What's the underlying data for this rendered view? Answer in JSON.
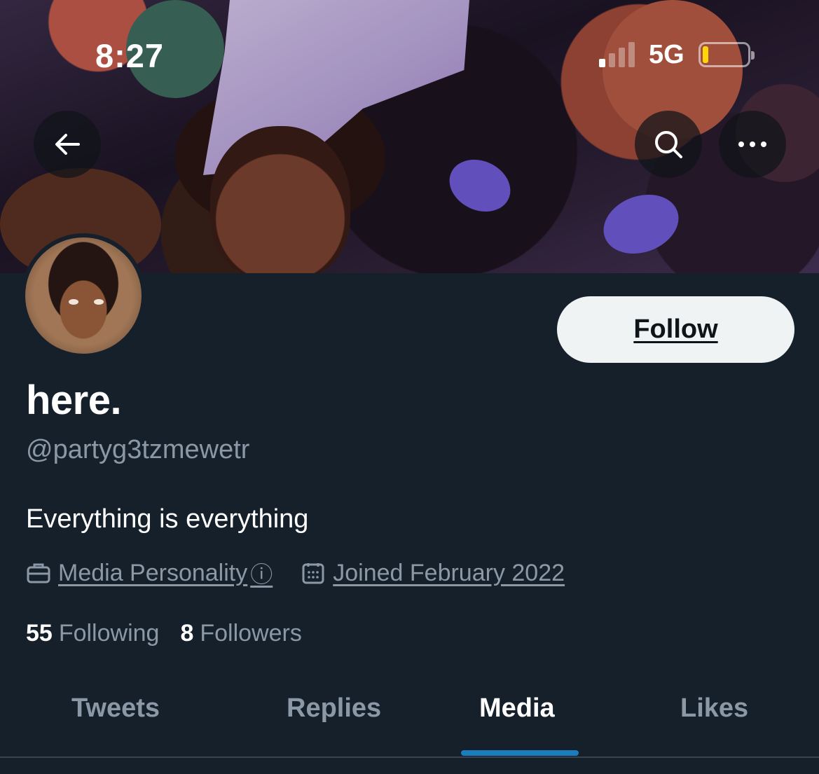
{
  "status_bar": {
    "time": "8:27",
    "network": "5G",
    "signal_bars_active": 1,
    "signal_bars_total": 4,
    "battery_level": 0.1,
    "battery_color": "#ffd60a"
  },
  "header": {
    "back_icon": "arrow-left-icon",
    "search_icon": "search-icon",
    "more_icon": "more-horizontal-icon"
  },
  "profile": {
    "display_name": "here.",
    "handle": "@partyg3tzmewetr",
    "bio": "Everything is everything",
    "category": "Media Personality",
    "category_info_glyph": "ⓘ",
    "joined": "Joined February 2022",
    "following_count": "55",
    "following_label": "Following",
    "followers_count": "8",
    "followers_label": "Followers"
  },
  "actions": {
    "follow_label": "Follow"
  },
  "tabs": [
    {
      "label": "Tweets",
      "active": false
    },
    {
      "label": "Replies",
      "active": false
    },
    {
      "label": "Media",
      "active": true
    },
    {
      "label": "Likes",
      "active": false
    }
  ],
  "colors": {
    "background": "#15202b",
    "accent": "#1d9bf0",
    "secondary_text": "#8b98a5",
    "follow_button_bg": "#eff3f4"
  }
}
